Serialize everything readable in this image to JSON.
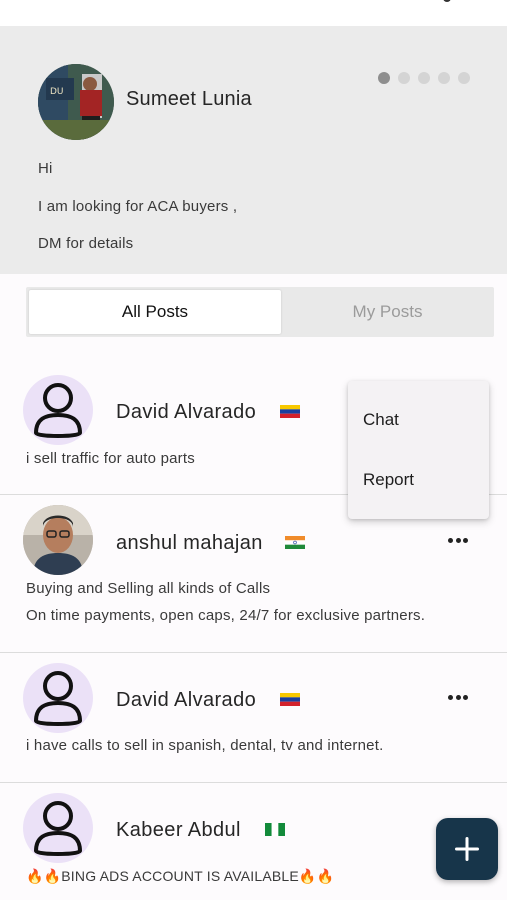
{
  "banner": {
    "author": "Sumeet Lunia",
    "lines": [
      "Hi",
      "I am looking for ACA buyers ,",
      "DM for details"
    ],
    "carousel_pages": 5,
    "carousel_active": 1
  },
  "tabs": [
    {
      "label": "All Posts",
      "selected": true
    },
    {
      "label": "My Posts",
      "selected": false
    }
  ],
  "posts": [
    {
      "name": "David Alvarado",
      "flag": "venezuela-flag-icon",
      "avatar": "person-outline-icon",
      "lines": [
        "i sell traffic for auto parts"
      ]
    },
    {
      "name": "anshul mahajan",
      "flag": "india-flag-icon",
      "avatar": "user-photo",
      "lines": [
        "Buying and Selling all kinds of Calls",
        "On time payments, open caps, 24/7 for exclusive partners."
      ]
    },
    {
      "name": "David Alvarado",
      "flag": "venezuela-flag-icon",
      "avatar": "person-outline-icon",
      "lines": [
        "i have calls to sell in spanish, dental, tv and internet."
      ]
    },
    {
      "name": "Kabeer Abdul",
      "flag": "nigeria-flag-icon",
      "avatar": "person-outline-icon",
      "lines": [
        "🔥🔥BING ADS ACCOUNT IS AVAILABLE🔥🔥"
      ]
    }
  ],
  "context_menu": {
    "items": [
      "Chat",
      "Report"
    ]
  },
  "fab": {
    "icon": "plus-icon"
  },
  "colors": {
    "banner_bg": "#ebebeb",
    "avatar_bg": "#ebe1f7",
    "fab_bg": "#17354a",
    "tab_inactive_text": "#9b9b9b"
  }
}
